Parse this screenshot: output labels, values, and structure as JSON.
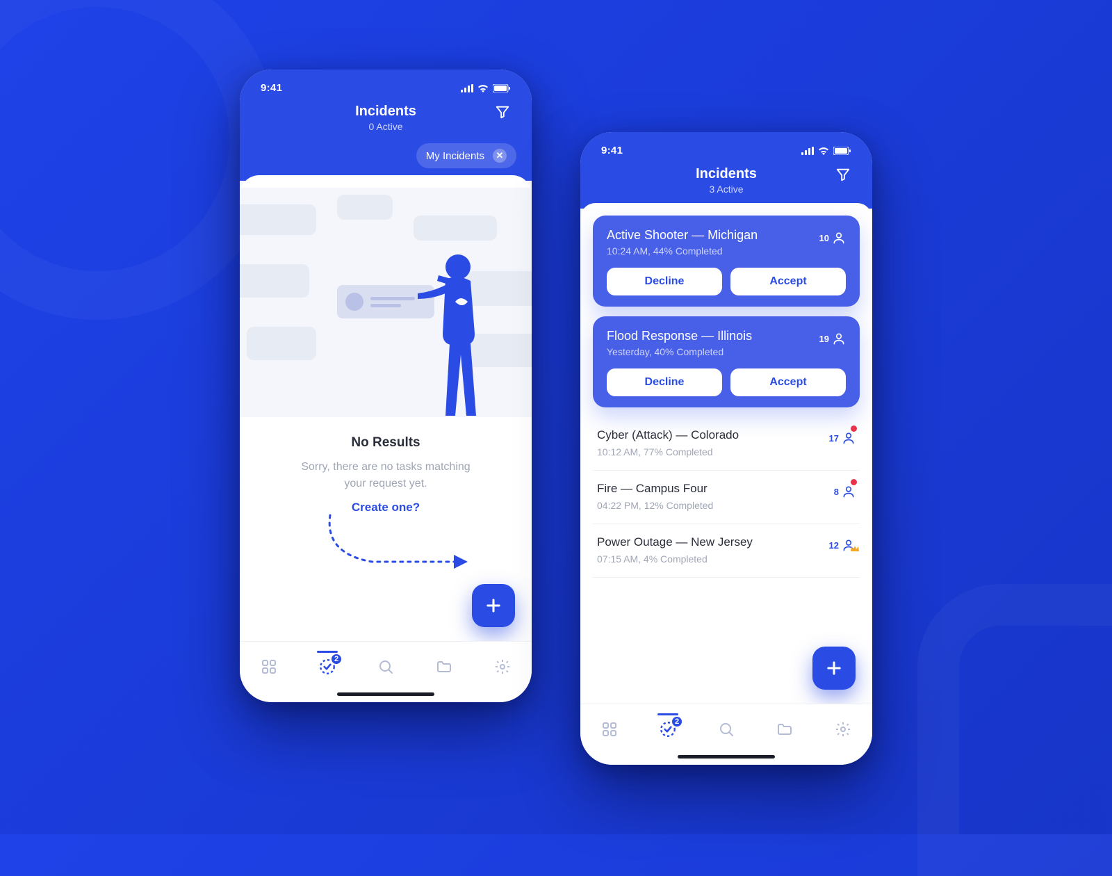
{
  "statusbar": {
    "time": "9:41"
  },
  "header": {
    "title": "Incidents"
  },
  "filter_chip": {
    "label": "My Incidents"
  },
  "empty": {
    "heading": "No Results",
    "body_line1": "Sorry, there are no tasks matching",
    "body_line2": "your request yet.",
    "cta": "Create one?"
  },
  "tabs": {
    "incidents_badge": "2"
  },
  "buttons": {
    "decline": "Decline",
    "accept": "Accept"
  },
  "phone1": {
    "active_count": "0 Active"
  },
  "phone2": {
    "active_count": "3 Active",
    "pending": [
      {
        "title": "Active Shooter — Michigan",
        "meta": "10:24 AM, 44% Completed",
        "people": "10"
      },
      {
        "title": "Flood Response — Illinois",
        "meta": "Yesterday, 40% Completed",
        "people": "19"
      }
    ],
    "incidents": [
      {
        "title": "Cyber (Attack) — Colorado",
        "meta": "10:12 AM, 77% Completed",
        "people": "17",
        "badge": "alert"
      },
      {
        "title": "Fire — Campus Four",
        "meta": "04:22 PM, 12% Completed",
        "people": "8",
        "badge": "alert"
      },
      {
        "title": "Power Outage — New Jersey",
        "meta": "07:15 AM, 4% Completed",
        "people": "12",
        "badge": "crown"
      }
    ]
  }
}
